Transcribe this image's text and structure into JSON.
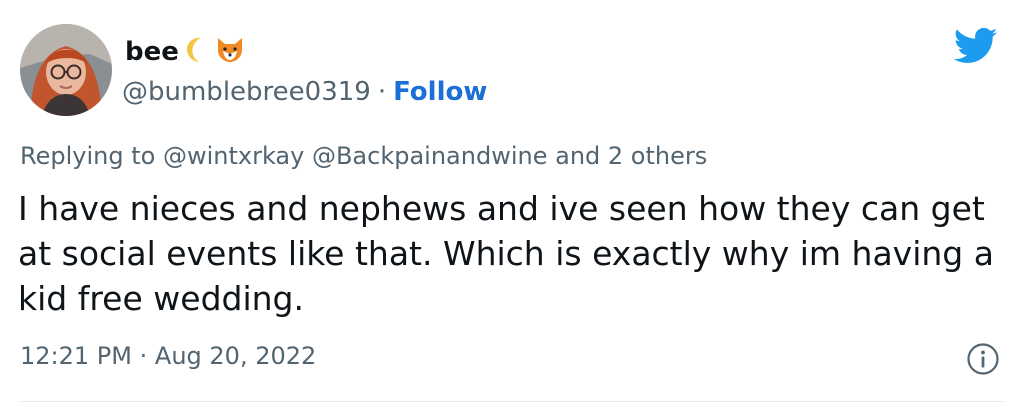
{
  "author": {
    "display_name": "bee",
    "handle": "@bumblebree0319",
    "separator": "·",
    "follow_label": "Follow",
    "name_emoji": [
      "moon-emoji",
      "fox-emoji"
    ]
  },
  "reply": {
    "prefix": "Replying to",
    "mentions": "@wintxrkay @Backpainandwine",
    "suffix": "and 2 others"
  },
  "tweet": {
    "text": "I have nieces and nephews and ive seen how they can get at social events like that. Which is exactly why im having a kid free wedding."
  },
  "meta": {
    "time": "12:21 PM",
    "separator": "·",
    "date": "Aug 20, 2022"
  },
  "icons": {
    "brand": "twitter-bird-icon",
    "info": "info-icon"
  },
  "colors": {
    "twitter_blue": "#1d9bf0",
    "follow_blue": "#1d6fd8",
    "text_primary": "#0f1419",
    "text_secondary": "#536471"
  }
}
